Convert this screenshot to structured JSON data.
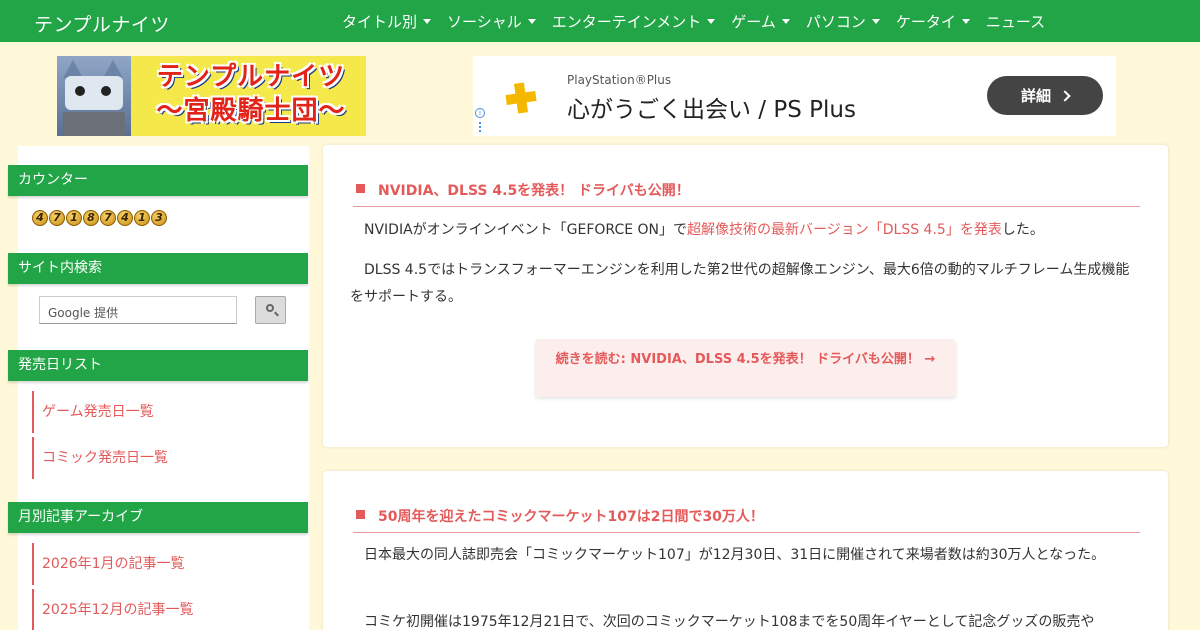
{
  "header": {
    "brand": "テンプルナイツ",
    "nav": [
      {
        "label": "タイトル別",
        "dropdown": true
      },
      {
        "label": "ソーシャル",
        "dropdown": true
      },
      {
        "label": "エンターテインメント",
        "dropdown": true
      },
      {
        "label": "ゲーム",
        "dropdown": true
      },
      {
        "label": "パソコン",
        "dropdown": true
      },
      {
        "label": "ケータイ",
        "dropdown": true
      },
      {
        "label": "ニュース",
        "dropdown": false
      }
    ]
  },
  "logo_banner": {
    "line1": "テンプルナイツ",
    "line2": "〜宮殿騎士団〜"
  },
  "ad": {
    "sub": "PlayStation®Plus",
    "title": "心がうごく出会い / PS Plus",
    "button": "詳細"
  },
  "sidebar": {
    "counter_title": "カウンター",
    "counter_digits": [
      "4",
      "7",
      "1",
      "8",
      "7",
      "4",
      "1",
      "3"
    ],
    "search_title": "サイト内検索",
    "search_placeholder": "Google 提供",
    "release_title": "発売日リスト",
    "release_links": [
      "ゲーム発売日一覧",
      "コミック発売日一覧"
    ],
    "archive_title": "月別記事アーカイブ",
    "archive_links": [
      "2026年1月の記事一覧",
      "2025年12月の記事一覧"
    ]
  },
  "articles": [
    {
      "title": "NVIDIA、DLSS 4.5を発表！ ドライバも公開！",
      "p1_before": "NVIDIAがオンラインイベント「GEFORCE ON」で",
      "p1_link": "超解像技術の最新バージョン「DLSS 4.5」を発表",
      "p1_after": "した。",
      "p2": "DLSS 4.5ではトランスフォーマーエンジンを利用した第2世代の超解像エンジン、最大6倍の動的マルチフレーム生成機能をサポートする。",
      "readmore": "続きを読む: NVIDIA、DLSS 4.5を発表！ ドライバも公開！ →"
    },
    {
      "title": "50周年を迎えたコミックマーケット107は2日間で30万人！",
      "p1": "日本最大の同人誌即売会「コミックマーケット107」が12月30日、31日に開催されて来場者数は約30万人となった。",
      "p2": "コミケ初開催は1975年12月21日で、次回のコミックマーケット108までを50周年イヤーとして記念グッズの販売や"
    }
  ],
  "colors": {
    "green": "#21a547",
    "accent": "#e45a5a",
    "background": "#fff9d9"
  }
}
